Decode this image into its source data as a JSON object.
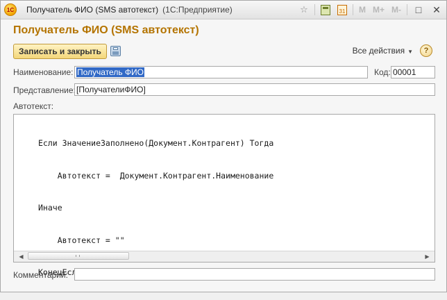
{
  "window": {
    "title": "Получатель ФИО (SMS автотекст)",
    "app_name": "(1С:Предприятие)",
    "logo_text": "1С",
    "memory_buttons": [
      "M",
      "M+",
      "M-"
    ],
    "calendar_day": "31"
  },
  "form": {
    "title": "Получатель ФИО (SMS автотекст)"
  },
  "toolbar": {
    "save_close_label": "Записать и закрыть",
    "all_actions_label": "Все действия",
    "help_label": "?"
  },
  "fields": {
    "name_label": "Наименование:",
    "name_value": "Получатель ФИО",
    "code_label": "Код:",
    "code_value": "00001",
    "representation_label": "Представление:",
    "representation_value": "[ПолучателиФИО]",
    "autotext_label": "Автотекст:",
    "comment_label": "Комментарий:",
    "comment_value": ""
  },
  "editor": {
    "lines": [
      "Если ЗначениеЗаполнено(Документ.Контрагент) Тогда",
      "    Автотекст =  Документ.Контрагент.Наименование",
      "Иначе",
      "    Автотекст = \"\"",
      "КонецЕсли"
    ]
  },
  "colors": {
    "form_title": "#b47400",
    "selection": "#3169c6",
    "save_button": "#f3d77a"
  }
}
